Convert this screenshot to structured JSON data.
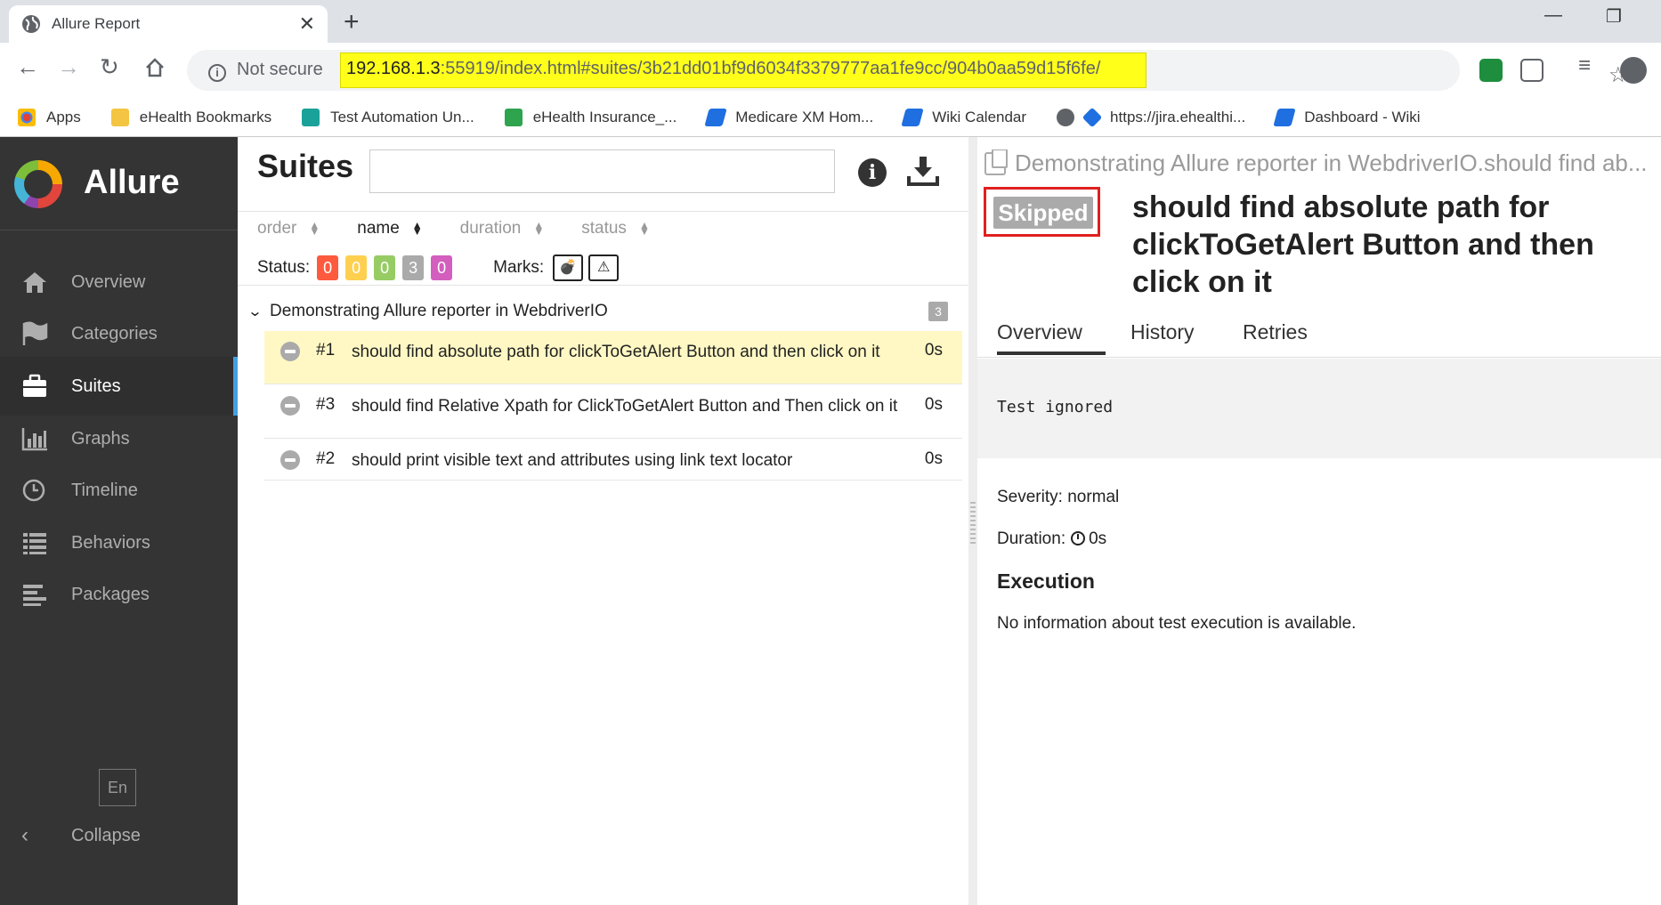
{
  "browser": {
    "tab_title": "Allure Report",
    "tab_close": "✕",
    "new_tab": "+",
    "not_secure": "Not secure",
    "url_host": "192.168.1.3",
    "url_rest": ":55919/index.html#suites/3b21dd01bf9d6034f3379777aa1fe9cc/904b0aa59d15f6fe/",
    "bookmarks": [
      {
        "label": "Apps",
        "color": "#e44134"
      },
      {
        "label": "eHealth Bookmarks",
        "color": "#f4c542"
      },
      {
        "label": "Test Automation Un...",
        "color": "#1aa29a"
      },
      {
        "label": "eHealth Insurance_...",
        "color": "#2ea44f"
      },
      {
        "label": "Medicare XM Hom...",
        "color": "#1f6fe0"
      },
      {
        "label": "Wiki Calendar",
        "color": "#1f6fe0"
      },
      {
        "label": "https://jira.ehealthi...",
        "color": "#1f6fe0"
      },
      {
        "label": "Dashboard - Wiki",
        "color": "#1f6fe0"
      }
    ]
  },
  "sidebar": {
    "brand": "Allure",
    "items": [
      {
        "label": "Overview",
        "icon": "home-icon"
      },
      {
        "label": "Categories",
        "icon": "flag-icon"
      },
      {
        "label": "Suites",
        "icon": "briefcase-icon",
        "active": true
      },
      {
        "label": "Graphs",
        "icon": "bar-chart-icon"
      },
      {
        "label": "Timeline",
        "icon": "clock-icon"
      },
      {
        "label": "Behaviors",
        "icon": "list-icon"
      },
      {
        "label": "Packages",
        "icon": "align-left-icon"
      }
    ],
    "language": "En",
    "collapse": "Collapse"
  },
  "suites": {
    "title": "Suites",
    "search_placeholder": "",
    "sorters": [
      {
        "label": "order"
      },
      {
        "label": "name",
        "active": true
      },
      {
        "label": "duration"
      },
      {
        "label": "status"
      }
    ],
    "status_label": "Status:",
    "status_counts": [
      {
        "value": "0",
        "color": "#fd5a3e"
      },
      {
        "value": "0",
        "color": "#ffd050"
      },
      {
        "value": "0",
        "color": "#97cc64"
      },
      {
        "value": "3",
        "color": "#aaaaaa"
      },
      {
        "value": "0",
        "color": "#d35ebe"
      }
    ],
    "marks_label": "Marks:",
    "group": {
      "name": "Demonstrating Allure reporter in WebdriverIO",
      "count": "3"
    },
    "tests": [
      {
        "num": "#1",
        "name": "should find absolute path for clickToGetAlert Button and then click on it",
        "duration": "0s",
        "selected": true
      },
      {
        "num": "#3",
        "name": "should find Relative Xpath for ClickToGetAlert Button and Then click on it",
        "duration": "0s"
      },
      {
        "num": "#2",
        "name": "should print visible text and attributes using link text locator",
        "duration": "0s"
      }
    ]
  },
  "detail": {
    "breadcrumb": "Demonstrating Allure reporter in WebdriverIO.should find ab...",
    "status": "Skipped",
    "title": "should find absolute path for clickToGetAlert Button and then click on it",
    "tabs": [
      "Overview",
      "History",
      "Retries"
    ],
    "status_message": "Test ignored",
    "severity": "Severity: normal",
    "duration_label": "Duration:",
    "duration_value": "0s",
    "execution_title": "Execution",
    "execution_message": "No information about test execution is available."
  }
}
